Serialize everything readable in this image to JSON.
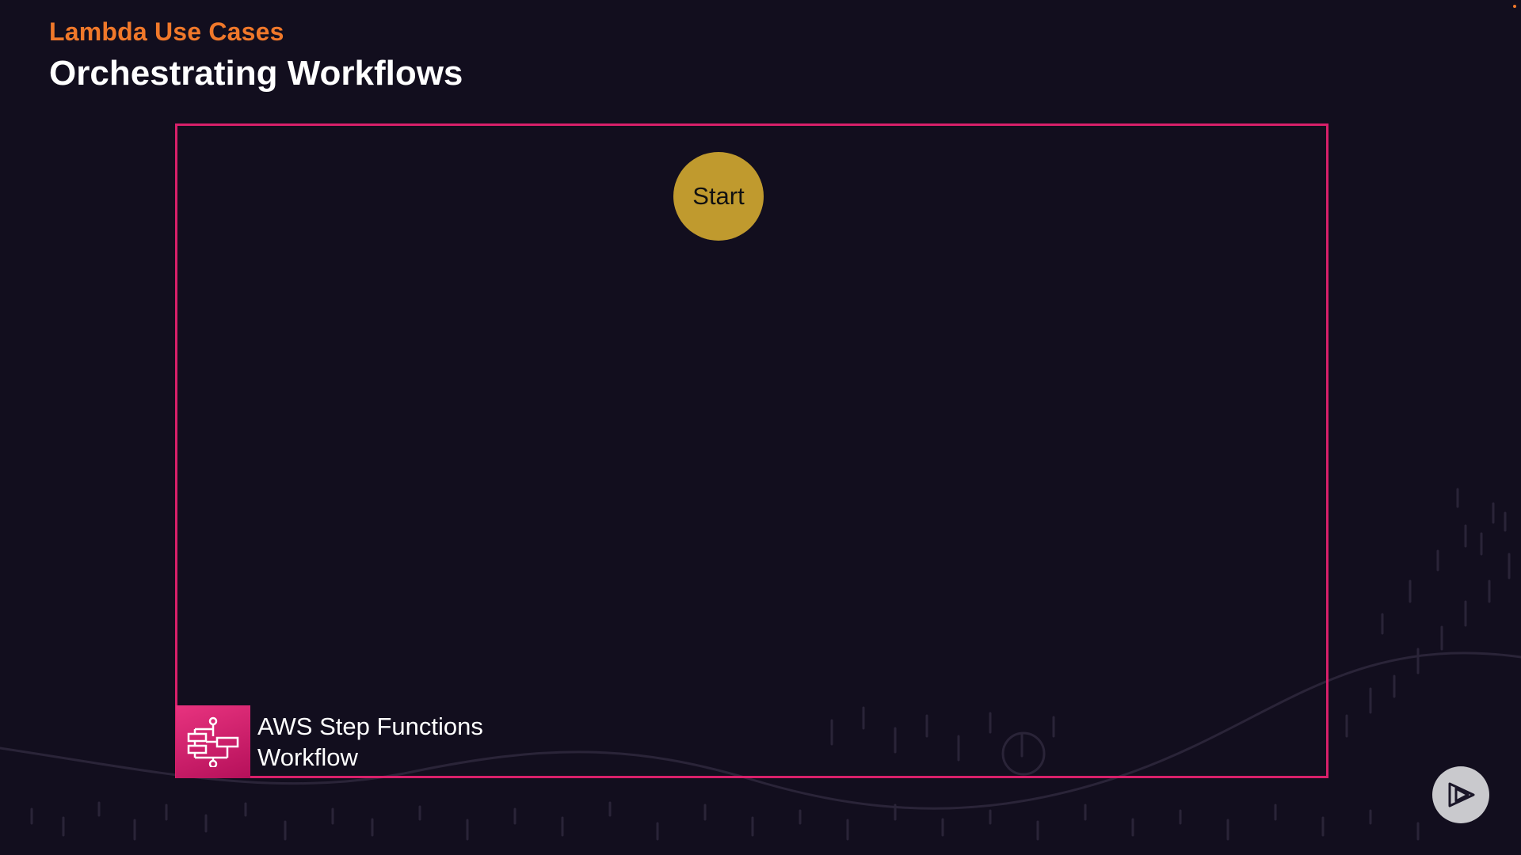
{
  "slide": {
    "eyebrow": "Lambda Use Cases",
    "title": "Orchestrating Workflows"
  },
  "diagram": {
    "start_node_label": "Start",
    "workflow_label_line1": "AWS Step Functions",
    "workflow_label_line2": "Workflow",
    "workflow_icon": "step-functions-icon"
  },
  "controls": {
    "play_icon": "play-icon"
  },
  "colors": {
    "background": "#120e1e",
    "accent_orange": "#f0782a",
    "frame_border": "#d8206a",
    "start_node": "#c09a2e",
    "icon_pink": "#e8337f"
  }
}
